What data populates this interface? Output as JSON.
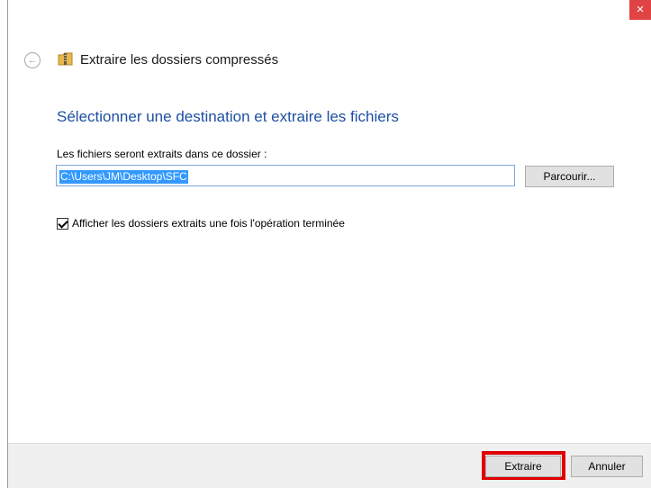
{
  "window": {
    "close_glyph": "×",
    "title": "Extraire les dossiers compressés",
    "back_icon": "back-arrow-icon",
    "folder_icon": "zip-folder-icon"
  },
  "main": {
    "heading": "Sélectionner une destination et extraire les fichiers",
    "destination_label": "Les fichiers seront extraits dans ce dossier :",
    "destination_value": "C:\\Users\\JM\\Desktop\\SFC",
    "browse_label": "Parcourir...",
    "show_folders_checked": true,
    "show_folders_label": "Afficher les dossiers extraits une fois l'opération terminée"
  },
  "footer": {
    "extract_label": "Extraire",
    "cancel_label": "Annuler"
  },
  "colors": {
    "heading": "#1e4fa3",
    "selection": "#3399ff",
    "close": "#e04343",
    "highlight": "#e00000"
  }
}
